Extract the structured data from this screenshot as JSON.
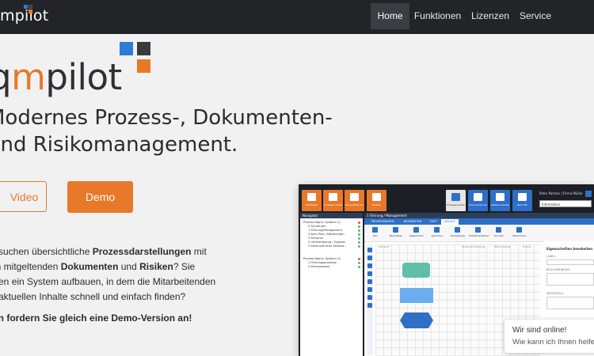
{
  "brand": {
    "logo_small": "mpilot",
    "logo_prefix": "q",
    "logo_m": "m",
    "logo_rest": "pilot",
    "colors": {
      "accent": "#e8782a",
      "blue": "#2e7cd6",
      "dark": "#3a3a3e"
    }
  },
  "nav": {
    "items": [
      {
        "label": "Home",
        "active": true
      },
      {
        "label": "Funktionen"
      },
      {
        "label": "Lizenzen"
      },
      {
        "label": "Service"
      }
    ]
  },
  "hero": {
    "headline_line1": "Modernes Prozess-, Dokumenten-",
    "headline_line2": "und Risikomanagement.",
    "video_button": "Video",
    "demo_button": "Demo",
    "para_l1_a": "e suchen übersichtliche ",
    "para_l1_b": "Prozessdarstellungen",
    "para_l1_c": " mit",
    "para_l2_a": "en mitgeltenden ",
    "para_l2_b": "Dokumenten",
    "para_l2_c": " und ",
    "para_l2_d": "Risiken",
    "para_l2_e": "? Sie",
    "para_l3": "hten ein System aufbauen, in dem die Mitarbeitenden",
    "para_l4": "e aktuellen Inhalte schnell und einfach finden?",
    "cta": "Dann fordern Sie gleich eine Demo-Version an!"
  },
  "app_preview": {
    "toolbar": [
      "Startseite",
      "Prozesse ansehen",
      "Dokumente ansehen",
      "Risiken",
      "Prozesse bearbeiten",
      "Dokumente bearbeiten",
      "Risiken bearbeiten",
      "Berichte"
    ],
    "user": "Peter Partner | Firma Müller",
    "user_dropdown": "Information",
    "navigator_title": "Navigator",
    "tree": [
      "Prozess-Mgmt.-System (1)",
      "0 Strukturen",
      "1 Führung/Management",
      "2 Kern-Proz. (Wertschöpf...",
      "3 Personal",
      "4 Unterstützung / Support",
      "5 Kontinuierliche Verbess...",
      "Prozess-Mgmt.-System (2)",
      "1 Führungsprozesse",
      "2 Kernprozesse"
    ],
    "main_title": "1 Führung / Management",
    "tabs": [
      "PROZESSDATEN",
      "BEARBEITEN",
      "TEXT",
      "ABLAUF"
    ],
    "ribbon": [
      "Neu",
      "Bearbeiten",
      "Abspeichern",
      "Speichern",
      "Rückgängig",
      "Wiederherstellen",
      "Drucken",
      "Maximieren"
    ],
    "columns": [
      "Ablauf",
      "Beschreibung",
      "Werkzeug",
      "Input"
    ],
    "props_title": "Eigenschaften bearbeiten",
    "props_labels": [
      "LABEL",
      "BESCHREIBUNG",
      "WERKZEUG"
    ]
  },
  "chat": {
    "line1": "Wir sind online!",
    "line2": "Wie kann ich Ihnen helfen?"
  }
}
